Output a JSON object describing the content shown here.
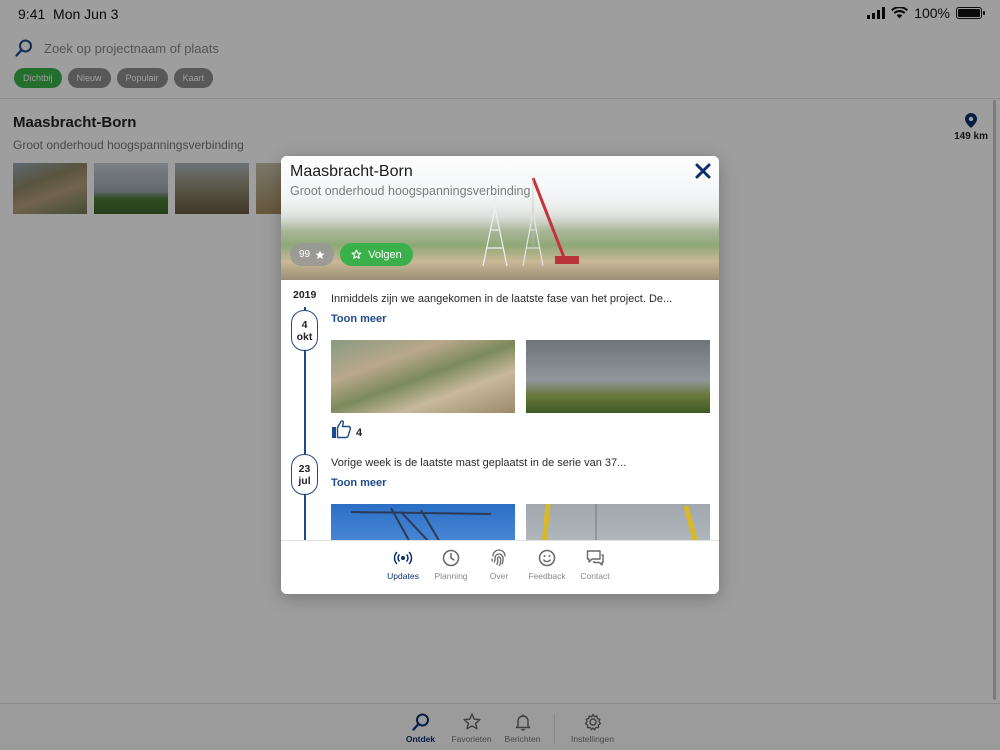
{
  "status_bar": {
    "time": "9:41",
    "date": "Mon Jun 3",
    "battery": "100%"
  },
  "search": {
    "placeholder": "Zoek op projectnaam of plaats"
  },
  "filters": [
    {
      "label": "Dichtbij",
      "active": true
    },
    {
      "label": "Nieuw",
      "active": false
    },
    {
      "label": "Populair",
      "active": false
    },
    {
      "label": "Kaart",
      "active": false
    }
  ],
  "project_card": {
    "title": "Maasbracht-Born",
    "subtitle": "Groot onderhoud hoogspanningsverbinding",
    "distance": "149 km"
  },
  "modal": {
    "title": "Maasbracht-Born",
    "subtitle": "Groot onderhoud hoogspanningsverbinding",
    "follow_count": "99",
    "follow_label": "Volgen",
    "year": "2019",
    "entries": [
      {
        "day": "4",
        "month": "okt",
        "text": "Inmiddels zijn we aangekomen in de laatste fase van het project. De...",
        "more": "Toon meer",
        "likes": "4"
      },
      {
        "day": "23",
        "month": "jul",
        "text": "Vorige week is de laatste mast geplaatst in de serie van 37...",
        "more": "Toon meer"
      }
    ],
    "nav": [
      "Updates",
      "Planning",
      "Over",
      "Feedback",
      "Contact"
    ]
  },
  "tabbar": [
    "Ontdek",
    "Favorieten",
    "Berichten",
    "Instellingen"
  ],
  "colors": {
    "accent_blue": "#1e4a8c",
    "active_green": "#39b24a",
    "nav_active": "#0a2f6e"
  }
}
